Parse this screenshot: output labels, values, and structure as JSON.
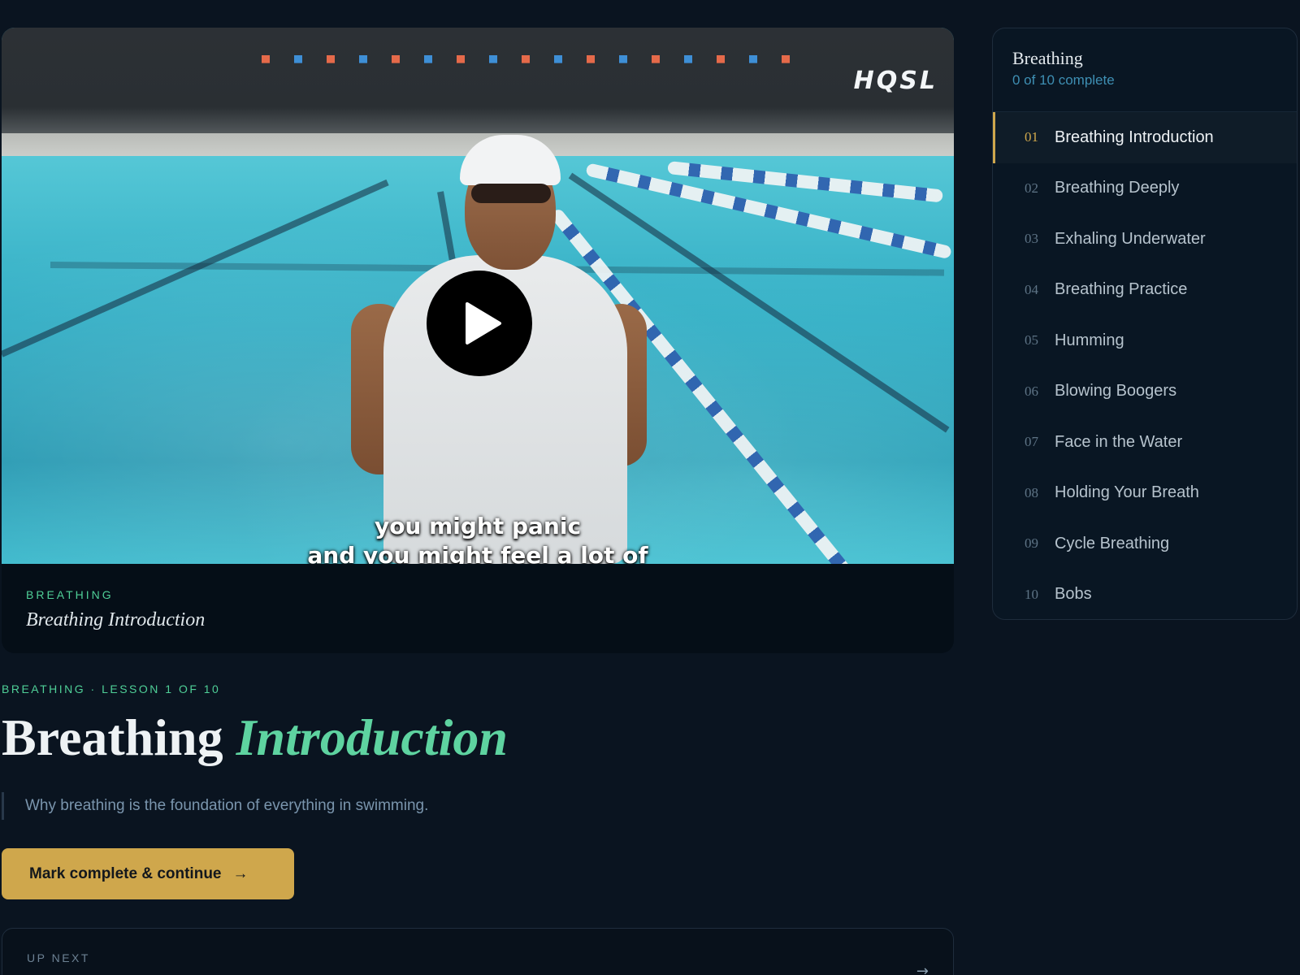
{
  "video": {
    "brand_logo": "HQSL",
    "caption_line1": "you might panic",
    "caption_line2": "and you might feel a lot of",
    "eyebrow": "BREATHING",
    "title": "Breathing Introduction"
  },
  "lesson": {
    "breadcrumb": "BREATHING · LESSON 1 OF 10",
    "title_plain": "Breathing ",
    "title_accent": "Introduction",
    "description": "Why breathing is the foundation of everything in swimming.",
    "cta_label": "Mark complete & continue",
    "cta_icon": "→",
    "up_next_label": "UP NEXT",
    "up_next_icon": "→"
  },
  "sidebar": {
    "module_name": "Breathing",
    "progress_text": "0 of 10 complete",
    "lessons": [
      {
        "num": "01",
        "title": "Breathing Introduction",
        "active": true
      },
      {
        "num": "02",
        "title": "Breathing Deeply",
        "active": false
      },
      {
        "num": "03",
        "title": "Exhaling Underwater",
        "active": false
      },
      {
        "num": "04",
        "title": "Breathing Practice",
        "active": false
      },
      {
        "num": "05",
        "title": "Humming",
        "active": false
      },
      {
        "num": "06",
        "title": "Blowing Boogers",
        "active": false
      },
      {
        "num": "07",
        "title": "Face in the Water",
        "active": false
      },
      {
        "num": "08",
        "title": "Holding Your Breath",
        "active": false
      },
      {
        "num": "09",
        "title": "Cycle Breathing",
        "active": false
      },
      {
        "num": "10",
        "title": "Bobs",
        "active": false
      }
    ]
  },
  "colors": {
    "background": "#0a1420",
    "accent_green": "#4fcf97",
    "accent_gold": "#cfa74c"
  }
}
